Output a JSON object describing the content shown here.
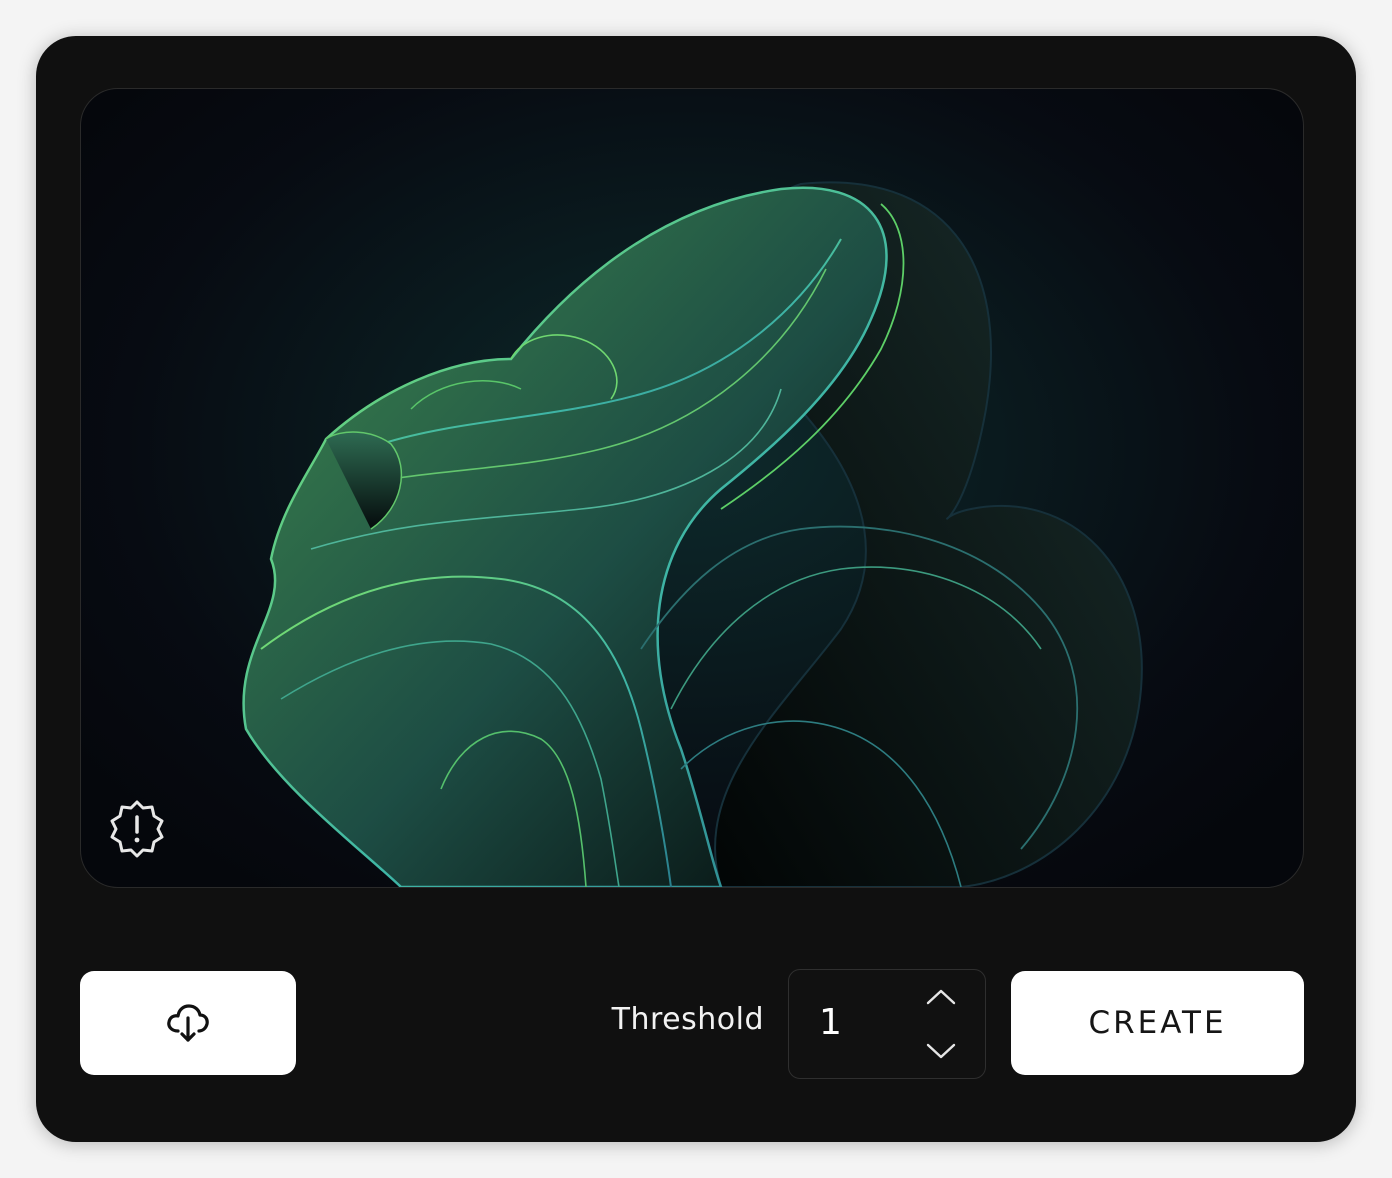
{
  "preview": {
    "image_subject": "abstract-green-ribbon-bloom",
    "status_icon": "alert-badge-icon"
  },
  "upload": {
    "icon": "cloud-download-icon"
  },
  "threshold": {
    "label": "Threshold",
    "value": "1",
    "up_icon": "chevron-up-icon",
    "down_icon": "chevron-down-icon"
  },
  "actions": {
    "create_label": "CREATE"
  },
  "colors": {
    "card_bg": "#101010",
    "page_bg": "#f4f4f4",
    "button_bg": "#ffffff",
    "ribbon_green": "#5fd36a",
    "ribbon_teal": "#3aa7b0"
  }
}
